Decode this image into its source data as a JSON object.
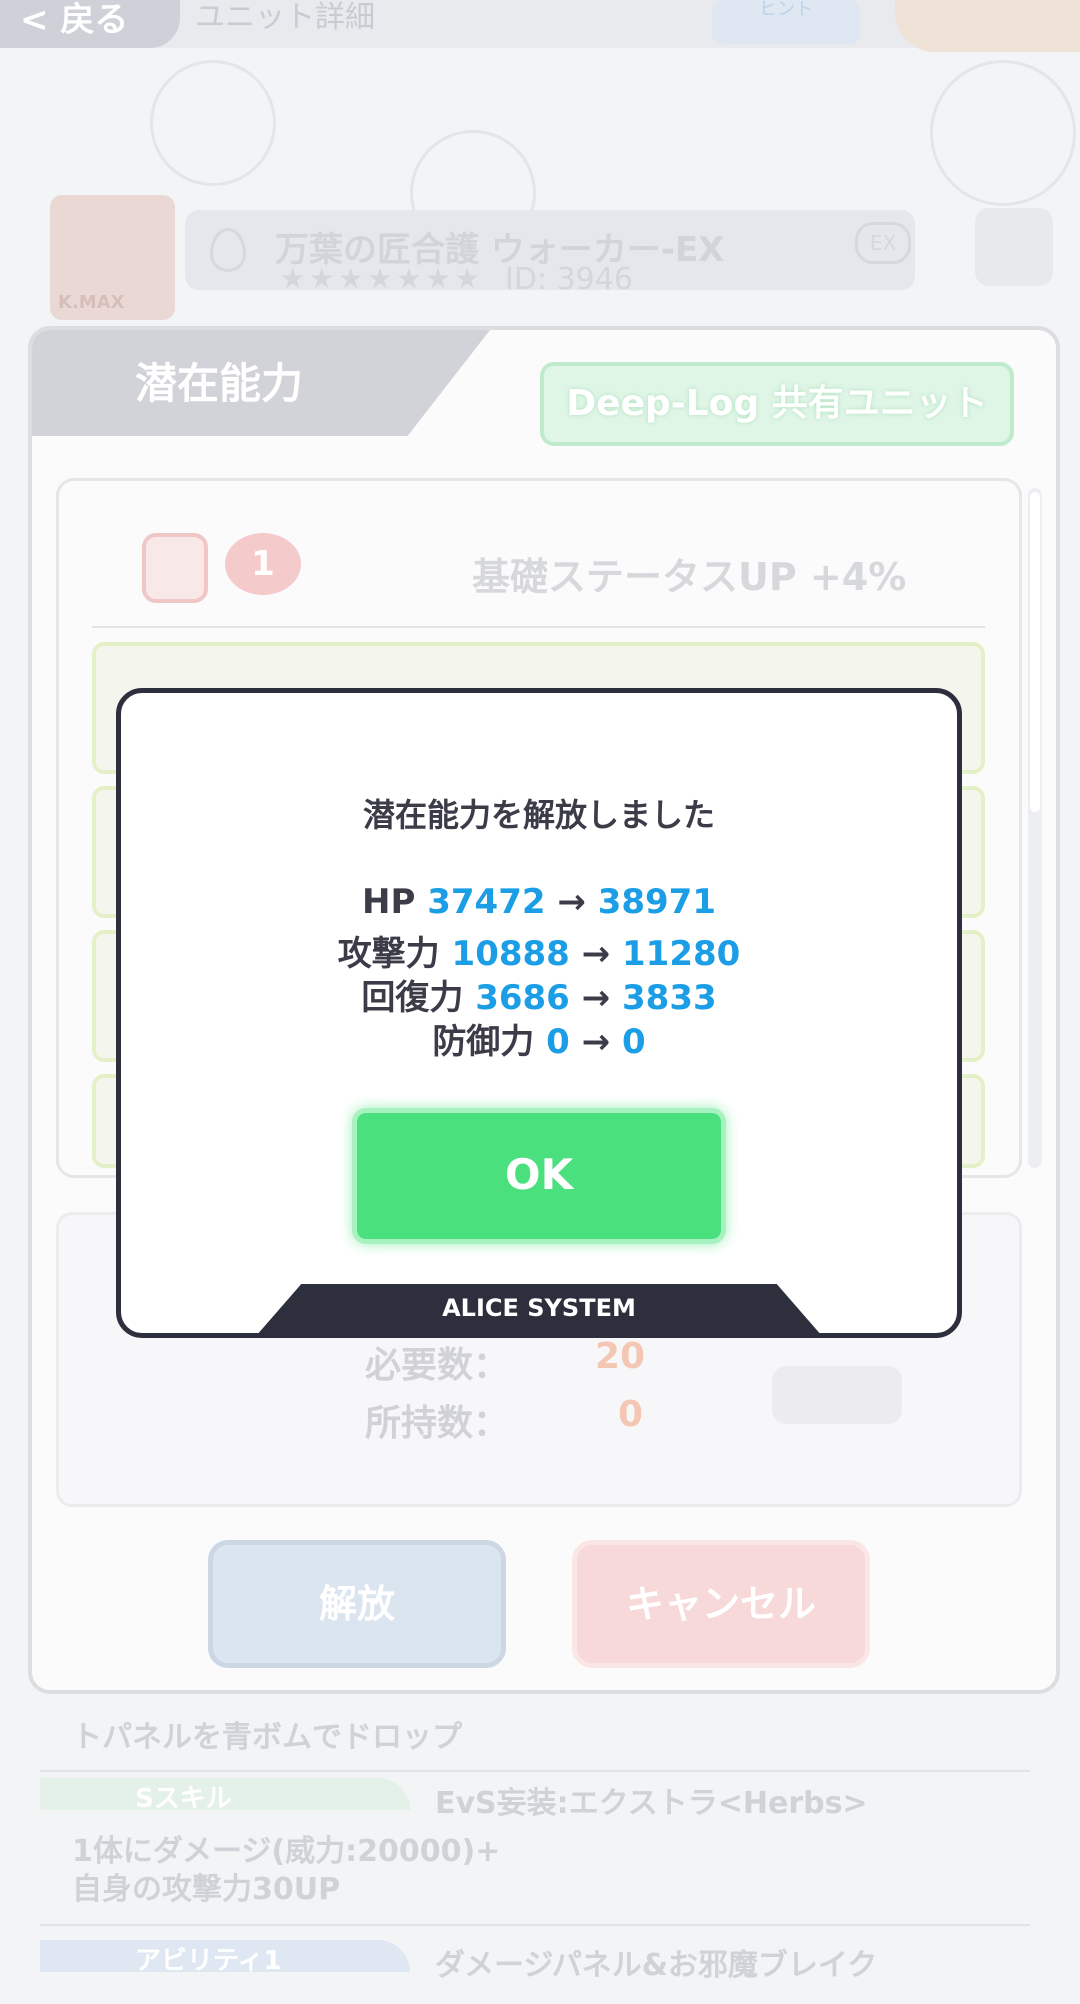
{
  "background": {
    "header": {
      "back_label": "< 戻る",
      "title": "ユニット詳細",
      "hint_label": "ヒント"
    },
    "unit": {
      "card_label": "K.MAX",
      "name": "万葉の匠合護 ウォーカー-EX",
      "stars": "★★★★★★★",
      "id": "ID: 3946",
      "ex_label": "EX"
    },
    "skills": {
      "desc_1": "トパネルを青ボムでドロップ",
      "skill_tag": "Sスキル",
      "skill_name": "EvS妄装:エクストラ<Herbs>",
      "skill_desc_1": "1体にダメージ(威力:20000)+",
      "skill_desc_2": "自身の攻撃力30UP",
      "ability_tag": "アビリティ1",
      "ability_name": "ダメージパネル&お邪魔ブレイク"
    }
  },
  "panel": {
    "tab_title": "潜在能力",
    "deeplog_label": "Deep-Log 共有ユニット",
    "first_row": {
      "badge": "1",
      "text": "基礎ステータスUP +4%"
    },
    "requirements": {
      "required_label": "必要数：",
      "required_value": "20",
      "owned_label": "所持数：",
      "owned_value": "0"
    },
    "release_button": "解放",
    "cancel_button": "キャンセル"
  },
  "modal": {
    "title": "潜在能力を解放しました",
    "stats": [
      {
        "label": "HP",
        "from": "37472",
        "arrow": "→",
        "to": "38971"
      },
      {
        "label": "攻撃力",
        "from": "10888",
        "arrow": "→",
        "to": "11280"
      },
      {
        "label": "回復力",
        "from": "3686",
        "arrow": "→",
        "to": "3833"
      },
      {
        "label": "防御力",
        "from": "0",
        "arrow": "→",
        "to": "0"
      }
    ],
    "ok_label": "OK",
    "footer_label": "ALICE SYSTEM"
  },
  "colors": {
    "accent_green": "#4be07e",
    "stat_blue": "#1b9ee6",
    "dialog_dark": "#2e2f3c"
  }
}
